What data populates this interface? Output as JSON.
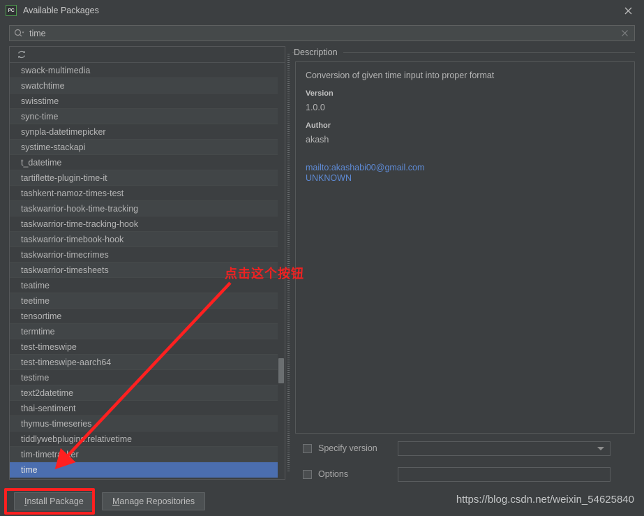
{
  "window": {
    "title": "Available Packages",
    "app_icon_label": "PC",
    "close_icon": "close-icon"
  },
  "search": {
    "icon": "search-icon",
    "value": "time",
    "placeholder": "",
    "clear_icon": "close-icon"
  },
  "list": {
    "refresh_icon": "refresh-icon",
    "selected": "time",
    "packages": [
      "swack-multimedia",
      "swatchtime",
      "swisstime",
      "sync-time",
      "synpla-datetimepicker",
      "systime-stackapi",
      "t_datetime",
      "tartiflette-plugin-time-it",
      "tashkent-namoz-times-test",
      "taskwarrior-hook-time-tracking",
      "taskwarrior-time-tracking-hook",
      "taskwarrior-timebook-hook",
      "taskwarrior-timecrimes",
      "taskwarrior-timesheets",
      "teatime",
      "teetime",
      "tensortime",
      "termtime",
      "test-timeswipe",
      "test-timeswipe-aarch64",
      "testime",
      "text2datetime",
      "thai-sentiment",
      "thymus-timeseries",
      "tiddlywebplugins.relativetime",
      "tim-timetracker",
      "time"
    ]
  },
  "description": {
    "group_title": "Description",
    "summary": "Conversion of given time input into proper format",
    "version_label": "Version",
    "version_value": "1.0.0",
    "author_label": "Author",
    "author_value": "akash",
    "links": [
      "mailto:akashabi00@gmail.com",
      "UNKNOWN"
    ]
  },
  "options": {
    "specify_version_label": "Specify version",
    "specify_version_checked": false,
    "specify_version_value": "",
    "options_label": "Options",
    "options_checked": false,
    "options_value": ""
  },
  "buttons": {
    "install_mnemonic": "I",
    "install_rest": "nstall Package",
    "manage_mnemonic": "M",
    "manage_rest": "anage Repositories"
  },
  "annotations": {
    "callout_text": "点击这个按钮",
    "watermark": "https://blog.csdn.net/weixin_54625840",
    "highlight_color": "#ff2020",
    "accent_color": "#4b6eaf",
    "link_color": "#5e8ad4"
  }
}
